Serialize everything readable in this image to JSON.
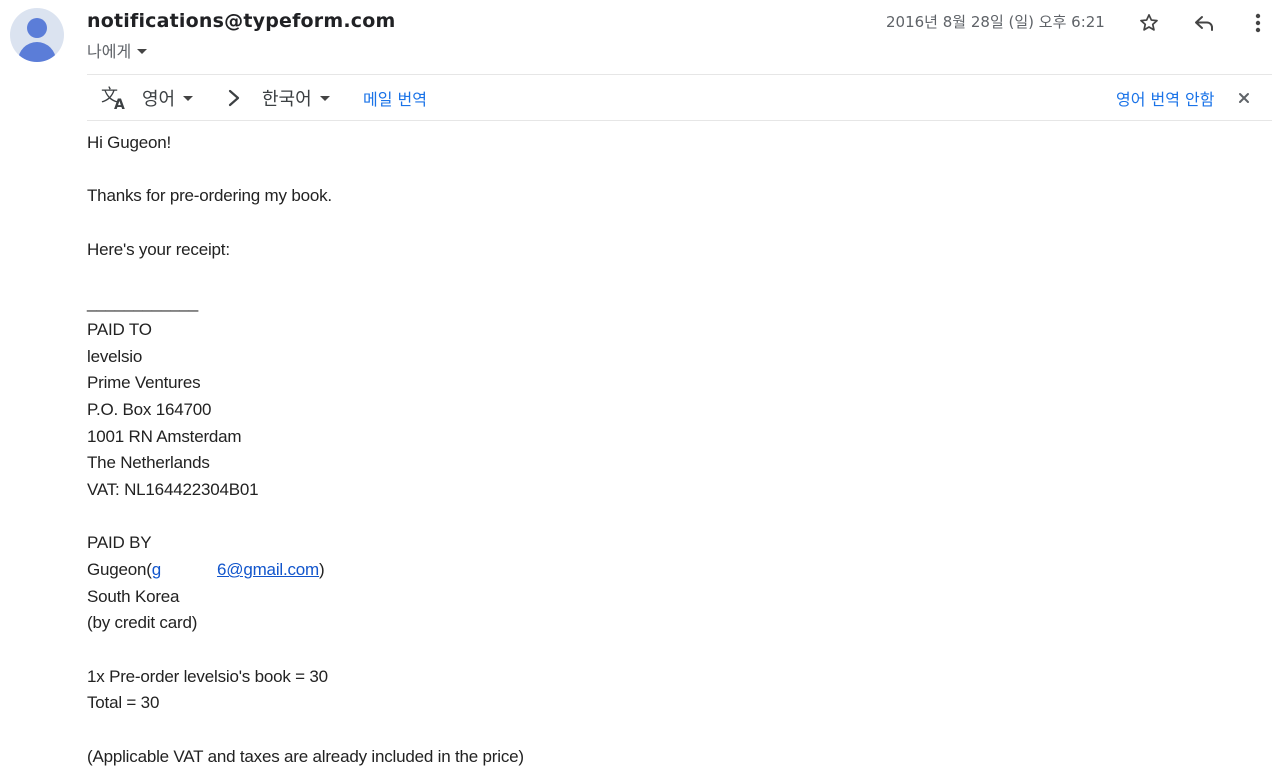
{
  "header": {
    "sender": "notifications@typeform.com",
    "recipient": "나에게",
    "date": "2016년 8월 28일 (일) 오후 6:21",
    "icons": [
      "star-icon",
      "reply-icon",
      "more-vert-icon"
    ]
  },
  "translate_bar": {
    "source_lang": "영어",
    "target_lang": "한국어",
    "translate_link": "메일 번역",
    "never_translate_link": "영어 번역 안함",
    "icons": [
      "translate-icon",
      "chevron-right-icon",
      "close-icon"
    ]
  },
  "body": {
    "greeting": "Hi Gugeon!",
    "thanks": "Thanks for pre-ordering my book.",
    "receipt_intro": "Here's your receipt:",
    "separator": "____________",
    "paid_to_heading": "PAID TO",
    "paid_to_lines": [
      "levelsio",
      "Prime Ventures",
      "P.O. Box 164700",
      "1001 RN Amsterdam",
      "The Netherlands",
      "VAT: NL164422304B01"
    ],
    "paid_by_heading": "PAID BY",
    "paid_by_name_prefix": "Gugeon(",
    "paid_by_email_start": "g",
    "paid_by_email_end": "6@gmail.com",
    "paid_by_name_suffix": ")",
    "paid_by_lines": [
      "South Korea",
      "(by credit card)"
    ],
    "order_line": "1x Pre-order levelsio's book = 30",
    "total_line": "Total = 30",
    "vat_note": "(Applicable VAT and taxes are already included in the price)"
  },
  "colors": {
    "link": "#1155cc",
    "translate_link": "#1a73e8",
    "avatar_bg": "#dbe3f0",
    "avatar_fg": "#5b7dd8"
  }
}
